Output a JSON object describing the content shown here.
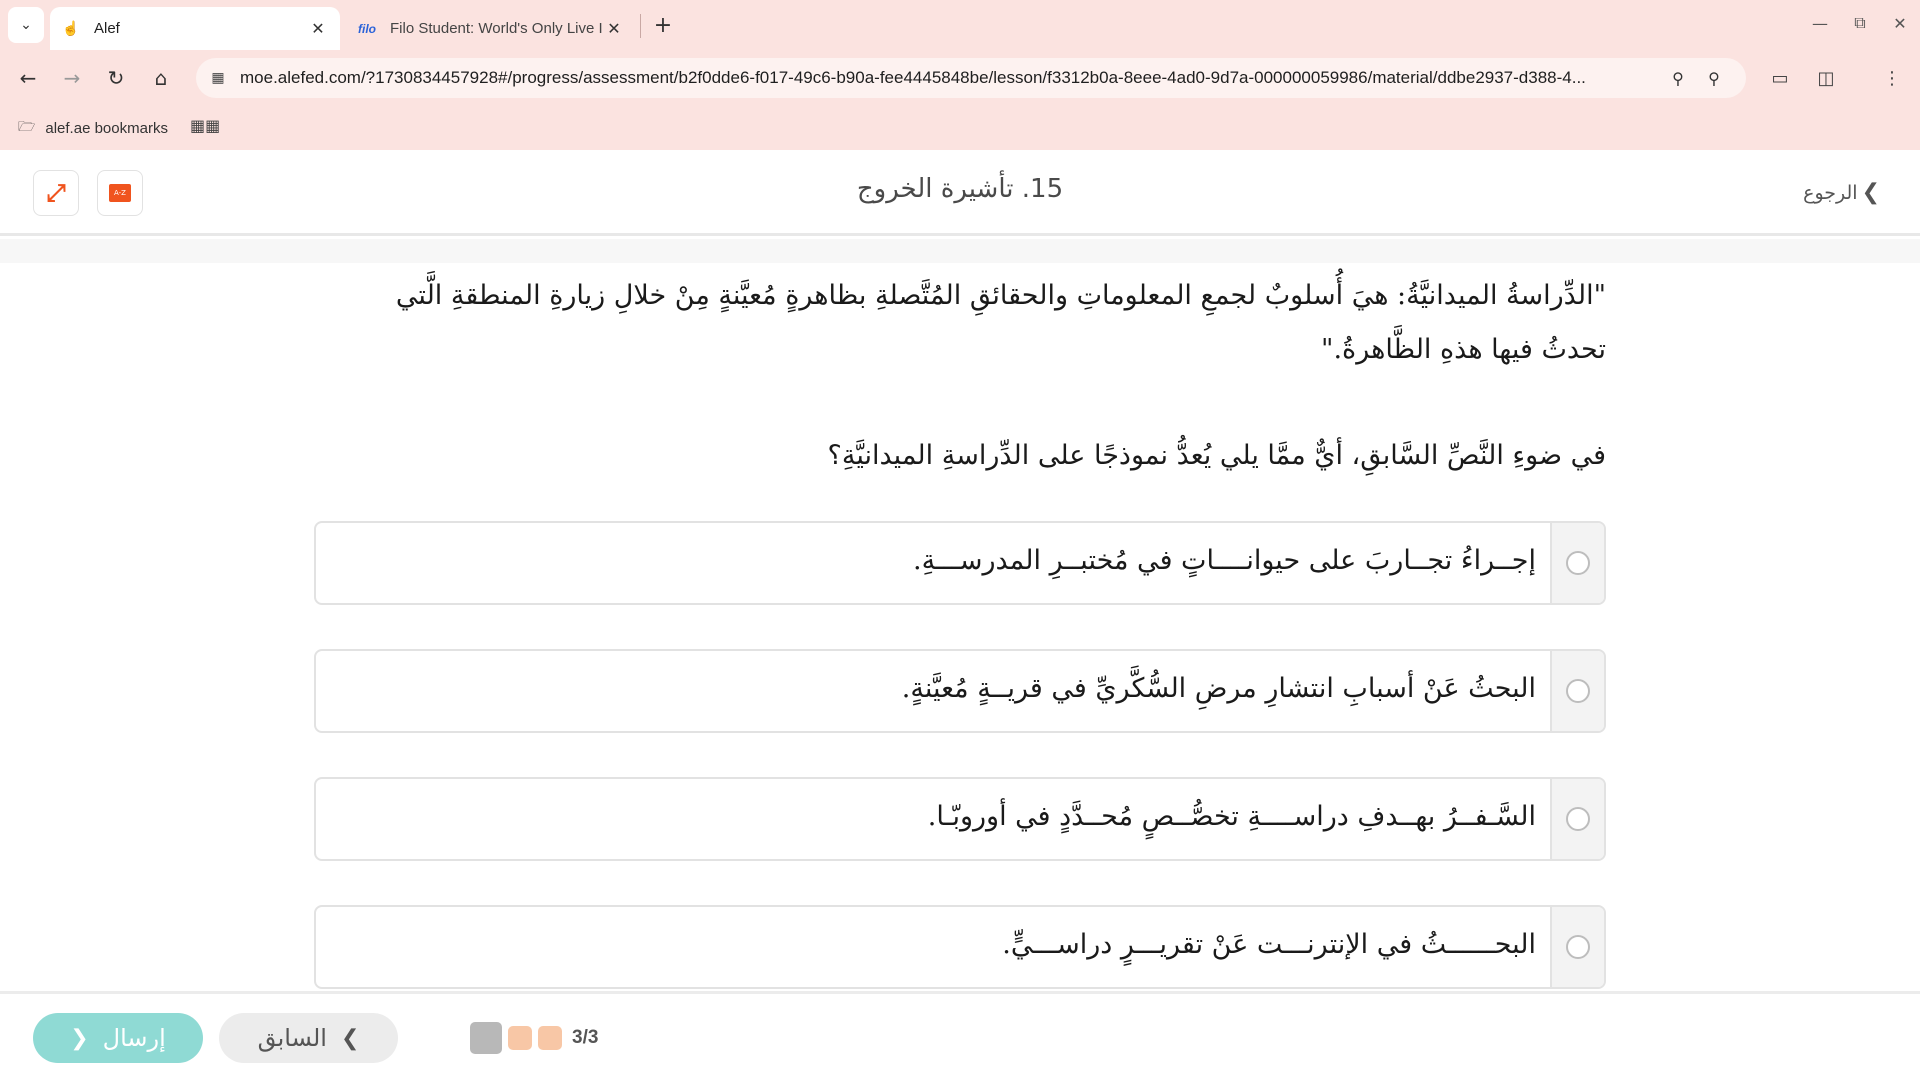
{
  "browser": {
    "tabs": [
      {
        "title": "Alef",
        "active": true,
        "icon": "hand-pointer-icon"
      },
      {
        "title": "Filo Student: World's Only Live I",
        "active": false,
        "icon": "filo-logo",
        "favicon_text": "filo"
      }
    ],
    "url": "moe.alefed.com/?1730834457928#/progress/assessment/b2f0dde6-f017-49c6-b90a-fee4445848be/lesson/f3312b0a-8eee-4ad0-9d7a-000000059986/material/ddbe2937-d388-4...",
    "bookmark_folder": "alef.ae bookmarks"
  },
  "header": {
    "title": "15. تأشيرة الخروج",
    "back_label": "الرجوع",
    "dictionary_label": "A-Z"
  },
  "passage": "\"الدِّراسةُ الميدانيَّةُ: هيَ أُسلوبٌ لجمعِ المعلوماتِ والحقائقِ المُتَّصلةِ بظاهرةٍ مُعيَّنةٍ مِنْ خلالِ زيارةِ المنطقةِ الَّتي تحدثُ فيها هذهِ الظَّاهرةُ.\"",
  "question": "في ضوءِ النَّصِّ السَّابقِ، أيٌّ ممَّا يلي يُعدُّ نموذجًا على الدِّراسةِ الميدانيَّةِ؟",
  "options": [
    {
      "text": "إجــراءُ تجــاربَ على حيوانــــاتٍ في مُختبــرِ المدرســـةِ."
    },
    {
      "text": "البحثُ عَنْ أسبابِ انتشارِ مرضِ السُّكَّريِّ في قريــةٍ مُعيَّنةٍ."
    },
    {
      "text": "السَّـفــرُ بهــدفِ دراســــةِ تخصُّــصٍ مُحــدَّدٍ في أوروبّـا."
    },
    {
      "text": "البحــــــثُ في الإنترنـــت عَنْ تقريـــرٍ دراســـيٍّ."
    }
  ],
  "footer": {
    "submit_label": "إرسال",
    "prev_label": "السابق",
    "progress": "3/3"
  },
  "colors": {
    "accent": "#f0541e",
    "submit": "#8fdad4",
    "chrome": "#fbe3e0"
  }
}
